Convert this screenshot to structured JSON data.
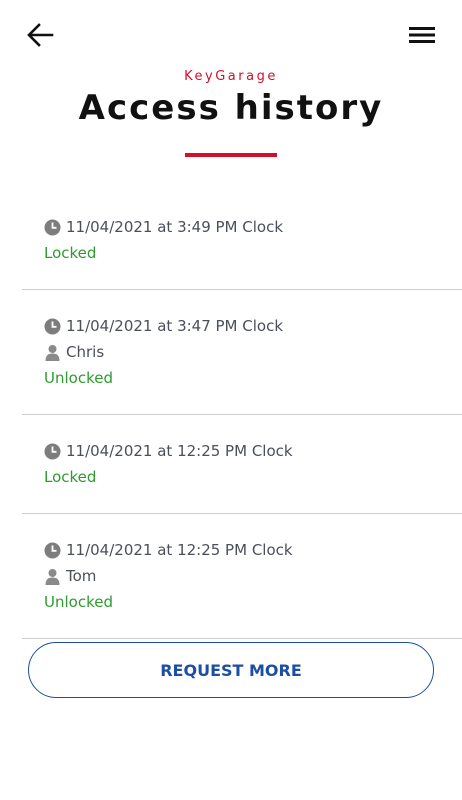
{
  "header": {
    "brand": "KeyGarage",
    "title": "Access history"
  },
  "entries": [
    {
      "time": "11/04/2021 at 3:49 PM Clock",
      "user": "",
      "status": "Locked"
    },
    {
      "time": "11/04/2021 at 3:47 PM Clock",
      "user": "Chris",
      "status": "Unlocked"
    },
    {
      "time": "11/04/2021 at 12:25 PM Clock",
      "user": "",
      "status": "Locked"
    },
    {
      "time": "11/04/2021 at 12:25 PM Clock",
      "user": "Tom",
      "status": "Unlocked"
    }
  ],
  "actions": {
    "request_more": "REQUEST MORE"
  },
  "colors": {
    "accent": "#d0112b",
    "status_green": "#2e9b2e",
    "button_blue": "#1c4fa3"
  },
  "icons": {
    "back": "arrow-left-icon",
    "menu": "hamburger-menu-icon",
    "time": "clock-icon",
    "user": "person-icon"
  }
}
